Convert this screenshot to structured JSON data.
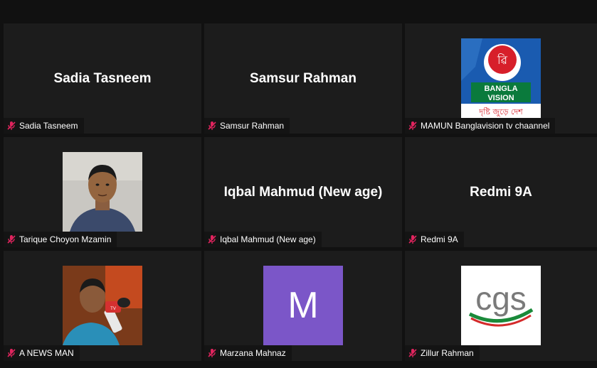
{
  "participants": [
    {
      "display": "Sadia Tasneem",
      "label": "Sadia Tasneem"
    },
    {
      "display": "Samsur Rahman",
      "label": "Samsur Rahman"
    },
    {
      "display": "",
      "label": "MAMUN Banglavision tv chaannel",
      "logo_text": "BANGLA VISION",
      "logo_tagline": "দৃষ্টি জুড়ে দেশ"
    },
    {
      "display": "",
      "label": "Tarique Choyon Mzamin"
    },
    {
      "display": "Iqbal Mahmud (New age)",
      "label": "Iqbal Mahmud (New age)"
    },
    {
      "display": "Redmi 9A",
      "label": "Redmi 9A"
    },
    {
      "display": "",
      "label": "A NEWS MAN"
    },
    {
      "display": "",
      "label": "Marzana Mahnaz",
      "avatar_letter": "M",
      "avatar_color": "#7b56c8"
    },
    {
      "display": "",
      "label": "Zillur Rahman",
      "logo_text": "cgs"
    }
  ],
  "icons": {
    "muted": "muted-mic-icon"
  },
  "colors": {
    "background": "#111111",
    "tile": "#1c1c1c",
    "muted": "#e0245e"
  }
}
